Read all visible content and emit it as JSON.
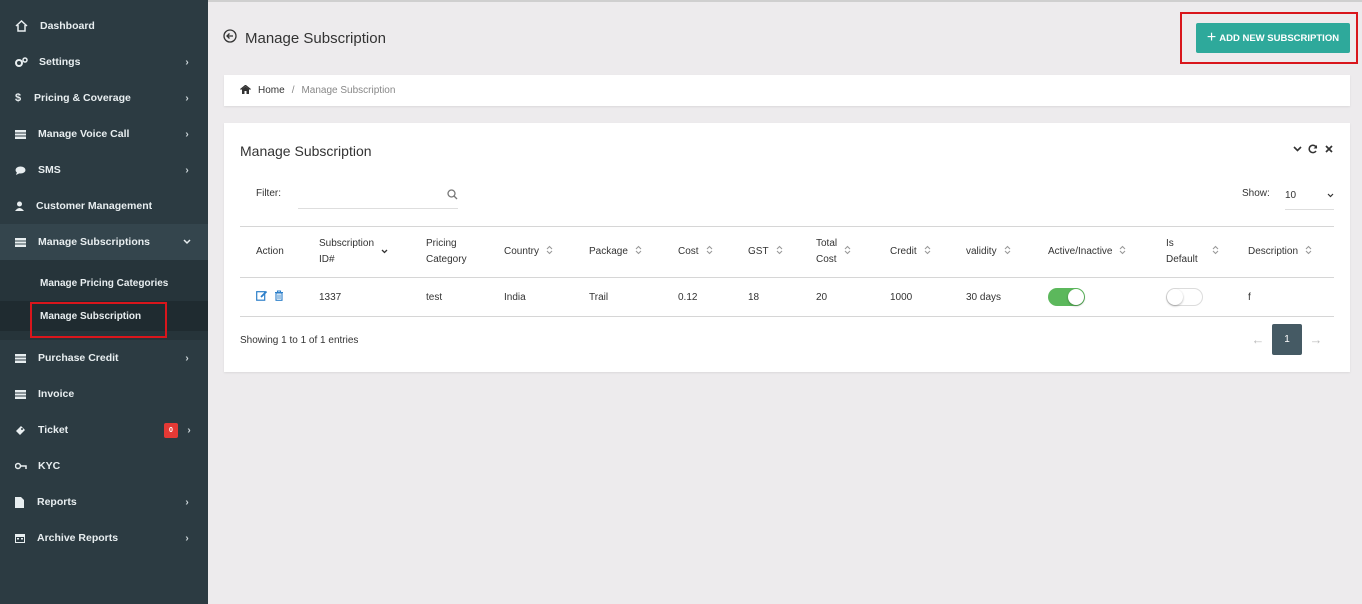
{
  "sidebar": {
    "items": [
      {
        "label": "Dashboard",
        "icon": "home-icon"
      },
      {
        "label": "Settings",
        "icon": "cogs-icon"
      },
      {
        "label": "Pricing & Coverage",
        "icon": "dollar-icon"
      },
      {
        "label": "Manage Voice Call",
        "icon": "list-icon"
      },
      {
        "label": "SMS",
        "icon": "comment-icon"
      },
      {
        "label": "Customer Management",
        "icon": "user-icon"
      },
      {
        "label": "Manage Subscriptions",
        "icon": "list-icon"
      },
      {
        "label": "Purchase Credit",
        "icon": "list-icon"
      },
      {
        "label": "Invoice",
        "icon": "list-icon"
      },
      {
        "label": "Ticket",
        "icon": "ticket-icon",
        "badge": "0"
      },
      {
        "label": "KYC",
        "icon": "key-icon"
      },
      {
        "label": "Reports",
        "icon": "file-icon"
      },
      {
        "label": "Archive Reports",
        "icon": "calendar-icon"
      }
    ],
    "submenu": [
      {
        "label": "Manage Pricing Categories"
      },
      {
        "label": "Manage Subscription"
      }
    ]
  },
  "header": {
    "title": "Manage Subscription",
    "add_button": "ADD NEW SUBSCRIPTION"
  },
  "breadcrumb": {
    "home": "Home",
    "separator": "/",
    "current": "Manage Subscription"
  },
  "card": {
    "title": "Manage Subscription",
    "filter_label": "Filter:",
    "filter_value": "",
    "show_label": "Show:",
    "show_value": "10",
    "columns": [
      {
        "l1": "Action",
        "l2": ""
      },
      {
        "l1": "Subscription",
        "l2": "ID#"
      },
      {
        "l1": "Pricing",
        "l2": "Category"
      },
      {
        "l1": "Country",
        "l2": ""
      },
      {
        "l1": "Package",
        "l2": ""
      },
      {
        "l1": "Cost",
        "l2": ""
      },
      {
        "l1": "GST",
        "l2": ""
      },
      {
        "l1": "Total",
        "l2": "Cost"
      },
      {
        "l1": "Credit",
        "l2": ""
      },
      {
        "l1": "validity",
        "l2": ""
      },
      {
        "l1": "Active/Inactive",
        "l2": ""
      },
      {
        "l1": "Is",
        "l2": "Default"
      },
      {
        "l1": "Description",
        "l2": ""
      }
    ],
    "rows": [
      {
        "id": "1337",
        "category": "test",
        "country": "India",
        "package": "Trail",
        "cost": "0.12",
        "gst": "18",
        "total_cost": "20",
        "credit": "1000",
        "validity": "30 days",
        "active": true,
        "is_default": false,
        "description": "f"
      }
    ],
    "showing": "Showing 1 to 1 of 1 entries",
    "pager": {
      "prev": "←",
      "page": "1",
      "next": "→"
    }
  },
  "colors": {
    "sidebar_bg": "#2c3b42",
    "accent": "#2ea99b",
    "highlight": "#d9161c",
    "toggle_on": "#5cb85c",
    "pager_active": "#455a64"
  }
}
